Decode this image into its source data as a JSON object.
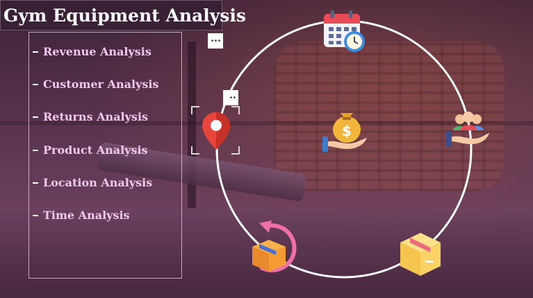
{
  "header": {
    "title": "Gym Equipment Analysis"
  },
  "menu": {
    "items": [
      {
        "label": "Revenue Analysis"
      },
      {
        "label": "Customer Analysis"
      },
      {
        "label": "Returns Analysis"
      },
      {
        "label": "Product Analysis"
      },
      {
        "label": "Location Analysis"
      },
      {
        "label": "Time Analysis"
      }
    ],
    "more_label": "•••"
  },
  "visual": {
    "more_label": "•••"
  },
  "icons": [
    "calendar-clock-icon",
    "money-bag-hand-icon",
    "customers-hand-icon",
    "return-box-icon",
    "product-box-icon",
    "location-pin-icon"
  ],
  "colors": {
    "menu_text": "#f2c9ef",
    "title_bg": "#3a2035",
    "ring": "#ffffff"
  }
}
